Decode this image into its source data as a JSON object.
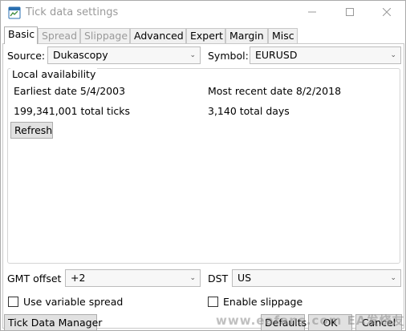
{
  "window": {
    "title": "Tick data settings",
    "app_icon": "tick-data-app-icon",
    "minimize_icon": "minimize-icon",
    "maximize_icon": "maximize-icon",
    "close_icon": "close-icon"
  },
  "tabs": [
    {
      "label": "Basic",
      "state": "active"
    },
    {
      "label": "Spread",
      "state": "disabled"
    },
    {
      "label": "Slippage",
      "state": "disabled"
    },
    {
      "label": "Advanced",
      "state": "enabled"
    },
    {
      "label": "Expert",
      "state": "enabled"
    },
    {
      "label": "Margin",
      "state": "enabled"
    },
    {
      "label": "Misc",
      "state": "enabled"
    }
  ],
  "source": {
    "label": "Source:",
    "value": "Dukascopy"
  },
  "symbol": {
    "label": "Symbol:",
    "value": "EURUSD"
  },
  "local": {
    "title": "Local availability",
    "earliest": "Earliest date 5/4/2003",
    "most_recent": "Most recent date 8/2/2018",
    "total_ticks": "199,341,001 total ticks",
    "total_days": "3,140 total days",
    "refresh_label": "Refresh"
  },
  "gmt": {
    "label": "GMT offset",
    "value": "+2"
  },
  "dst": {
    "label": "DST",
    "value": "US"
  },
  "checks": {
    "variable_spread": {
      "label": "Use variable spread",
      "checked": false
    },
    "slippage": {
      "label": "Enable slippage",
      "checked": false
    }
  },
  "footer": {
    "manager_label": "Tick Data Manager",
    "defaults_label": "Defaults",
    "ok_label": "OK",
    "cancel_label": "Cancel"
  },
  "watermark": "www.eafans.com EA发烧友"
}
